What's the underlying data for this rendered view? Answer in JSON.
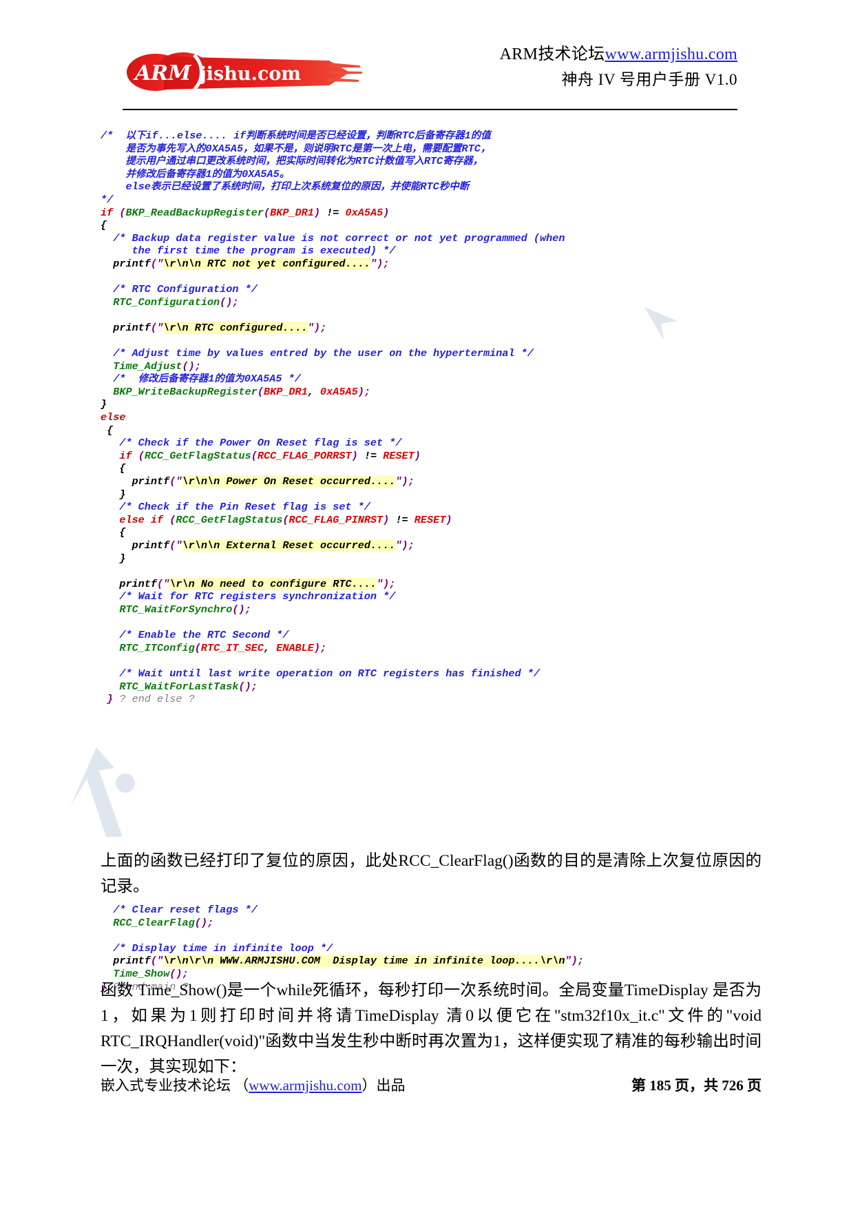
{
  "header": {
    "logo_alt": "ARMjishu.com",
    "logo_text_arm": "ARM",
    "logo_text_site": "jishu.com",
    "line1_prefix": "ARM技术论坛",
    "line1_url": "www.armjishu.com",
    "line2": "神舟 IV 号用户手册 V1.0"
  },
  "code": {
    "lines": [
      [
        {
          "t": "/*  ",
          "c": "c-comment"
        },
        {
          "t": "以下",
          "c": "c-cjk"
        },
        {
          "t": "if...else.... if",
          "c": "c-comment"
        },
        {
          "t": "判断系统时间是否已经设置，判断",
          "c": "c-cjk"
        },
        {
          "t": "RTC",
          "c": "c-comment"
        },
        {
          "t": "后备寄存器",
          "c": "c-cjk"
        },
        {
          "t": "1",
          "c": "c-comment"
        },
        {
          "t": "的值",
          "c": "c-cjk"
        }
      ],
      [
        {
          "t": "    ",
          "c": "c-comment"
        },
        {
          "t": "是否为事先写入的",
          "c": "c-cjk"
        },
        {
          "t": "0XA5A5",
          "c": "c-comment"
        },
        {
          "t": "，如果不是，则说明",
          "c": "c-cjk"
        },
        {
          "t": "RTC",
          "c": "c-comment"
        },
        {
          "t": "是第一次上电，需要配置",
          "c": "c-cjk"
        },
        {
          "t": "RTC",
          "c": "c-comment"
        },
        {
          "t": "，",
          "c": "c-cjk"
        }
      ],
      [
        {
          "t": "    ",
          "c": "c-comment"
        },
        {
          "t": "提示用户通过串口更改系统时间，把实际时间转化为",
          "c": "c-cjk"
        },
        {
          "t": "RTC",
          "c": "c-comment"
        },
        {
          "t": "计数值写入",
          "c": "c-cjk"
        },
        {
          "t": "RTC",
          "c": "c-comment"
        },
        {
          "t": "寄存器，",
          "c": "c-cjk"
        }
      ],
      [
        {
          "t": "    ",
          "c": "c-comment"
        },
        {
          "t": "并修改后备寄存器",
          "c": "c-cjk"
        },
        {
          "t": "1",
          "c": "c-comment"
        },
        {
          "t": "的值为",
          "c": "c-cjk"
        },
        {
          "t": "0XA5A5",
          "c": "c-comment"
        },
        {
          "t": "。",
          "c": "c-cjk"
        }
      ],
      [
        {
          "t": "    else",
          "c": "c-comment"
        },
        {
          "t": "表示已经设置了系统时间，打印上次系统复位的原因，并使能",
          "c": "c-cjk"
        },
        {
          "t": "RTC",
          "c": "c-comment"
        },
        {
          "t": "秒中断",
          "c": "c-cjk"
        }
      ],
      [
        {
          "t": "*/",
          "c": "c-comment"
        }
      ],
      [
        {
          "t": "if",
          "c": "c-kw"
        },
        {
          "t": " (",
          "c": "c-punc"
        },
        {
          "t": "BKP_ReadBackupRegister",
          "c": "c-fn"
        },
        {
          "t": "(",
          "c": "c-punc"
        },
        {
          "t": "BKP_DR1",
          "c": "c-const"
        },
        {
          "t": ")",
          "c": "c-punc"
        },
        {
          "t": " != ",
          "c": "c-plain"
        },
        {
          "t": "0xA5A5",
          "c": "c-const"
        },
        {
          "t": ")",
          "c": "c-punc"
        }
      ],
      [
        {
          "t": "{",
          "c": "c-plain"
        }
      ],
      [
        {
          "t": "  /* Backup data register value is not correct or not yet programmed (when",
          "c": "c-comment"
        }
      ],
      [
        {
          "t": "     the first time the program is executed) */",
          "c": "c-comment"
        }
      ],
      [
        {
          "t": "  printf",
          "c": "c-plain"
        },
        {
          "t": "(",
          "c": "c-punc"
        },
        {
          "t": "\"",
          "c": "c-strq"
        },
        {
          "t": "\\r\\n\\n RTC not yet configured....",
          "c": "c-str"
        },
        {
          "t": "\"",
          "c": "c-strq"
        },
        {
          "t": ")",
          "c": "c-punc"
        },
        {
          "t": ";",
          "c": "c-punc"
        }
      ],
      [],
      [
        {
          "t": "  /* RTC Configuration */",
          "c": "c-comment"
        }
      ],
      [
        {
          "t": "  RTC_Configuration",
          "c": "c-fn"
        },
        {
          "t": "();",
          "c": "c-punc"
        }
      ],
      [],
      [
        {
          "t": "  printf",
          "c": "c-plain"
        },
        {
          "t": "(",
          "c": "c-punc"
        },
        {
          "t": "\"",
          "c": "c-strq"
        },
        {
          "t": "\\r\\n RTC configured....",
          "c": "c-str"
        },
        {
          "t": "\"",
          "c": "c-strq"
        },
        {
          "t": ");",
          "c": "c-punc"
        }
      ],
      [],
      [
        {
          "t": "  /* Adjust time by values entred by the user on the hyperterminal */",
          "c": "c-comment"
        }
      ],
      [
        {
          "t": "  Time_Adjust",
          "c": "c-fn"
        },
        {
          "t": "();",
          "c": "c-punc"
        }
      ],
      [
        {
          "t": "  /*  ",
          "c": "c-comment"
        },
        {
          "t": "修改后备寄存器",
          "c": "c-cjk"
        },
        {
          "t": "1",
          "c": "c-comment"
        },
        {
          "t": "的值为",
          "c": "c-cjk"
        },
        {
          "t": "0XA5A5 */",
          "c": "c-comment"
        }
      ],
      [
        {
          "t": "  BKP_WriteBackupRegister",
          "c": "c-fn"
        },
        {
          "t": "(",
          "c": "c-punc"
        },
        {
          "t": "BKP_DR1",
          "c": "c-const"
        },
        {
          "t": ", ",
          "c": "c-plain"
        },
        {
          "t": "0xA5A5",
          "c": "c-const"
        },
        {
          "t": ");",
          "c": "c-punc"
        }
      ],
      [
        {
          "t": "}",
          "c": "c-plain"
        }
      ],
      [
        {
          "t": "else",
          "c": "c-kw"
        }
      ],
      [
        {
          "t": " {",
          "c": "c-plain"
        }
      ],
      [
        {
          "t": "   /* Check if the Power On Reset flag is set */",
          "c": "c-comment"
        }
      ],
      [
        {
          "t": "   if",
          "c": "c-kw"
        },
        {
          "t": " (",
          "c": "c-punc"
        },
        {
          "t": "RCC_GetFlagStatus",
          "c": "c-fn"
        },
        {
          "t": "(",
          "c": "c-punc"
        },
        {
          "t": "RCC_FLAG_PORRST",
          "c": "c-const"
        },
        {
          "t": ")",
          "c": "c-punc"
        },
        {
          "t": " != ",
          "c": "c-plain"
        },
        {
          "t": "RESET",
          "c": "c-const"
        },
        {
          "t": ")",
          "c": "c-punc"
        }
      ],
      [
        {
          "t": "   {",
          "c": "c-plain"
        }
      ],
      [
        {
          "t": "     printf",
          "c": "c-plain"
        },
        {
          "t": "(",
          "c": "c-punc"
        },
        {
          "t": "\"",
          "c": "c-strq"
        },
        {
          "t": "\\r\\n\\n Power On Reset occurred....",
          "c": "c-str"
        },
        {
          "t": "\"",
          "c": "c-strq"
        },
        {
          "t": ");",
          "c": "c-punc"
        }
      ],
      [
        {
          "t": "   }",
          "c": "c-plain"
        }
      ],
      [
        {
          "t": "   /* Check if the Pin Reset flag is set */",
          "c": "c-comment"
        }
      ],
      [
        {
          "t": "   else if",
          "c": "c-kw"
        },
        {
          "t": " (",
          "c": "c-punc"
        },
        {
          "t": "RCC_GetFlagStatus",
          "c": "c-fn"
        },
        {
          "t": "(",
          "c": "c-punc"
        },
        {
          "t": "RCC_FLAG_PINRST",
          "c": "c-const"
        },
        {
          "t": ")",
          "c": "c-punc"
        },
        {
          "t": " != ",
          "c": "c-plain"
        },
        {
          "t": "RESET",
          "c": "c-const"
        },
        {
          "t": ")",
          "c": "c-punc"
        }
      ],
      [
        {
          "t": "   {",
          "c": "c-plain"
        }
      ],
      [
        {
          "t": "     printf",
          "c": "c-plain"
        },
        {
          "t": "(",
          "c": "c-punc"
        },
        {
          "t": "\"",
          "c": "c-strq"
        },
        {
          "t": "\\r\\n\\n External Reset occurred....",
          "c": "c-str"
        },
        {
          "t": "\"",
          "c": "c-strq"
        },
        {
          "t": ");",
          "c": "c-punc"
        }
      ],
      [
        {
          "t": "   }",
          "c": "c-plain"
        }
      ],
      [],
      [
        {
          "t": "   printf",
          "c": "c-plain"
        },
        {
          "t": "(",
          "c": "c-punc"
        },
        {
          "t": "\"",
          "c": "c-strq"
        },
        {
          "t": "\\r\\n No need to configure RTC....",
          "c": "c-str"
        },
        {
          "t": "\"",
          "c": "c-strq"
        },
        {
          "t": ");",
          "c": "c-punc"
        }
      ],
      [
        {
          "t": "   /* Wait for RTC registers synchronization */",
          "c": "c-comment"
        }
      ],
      [
        {
          "t": "   RTC_WaitForSynchro",
          "c": "c-fn"
        },
        {
          "t": "();",
          "c": "c-punc"
        }
      ],
      [],
      [
        {
          "t": "   /* Enable the RTC Second */",
          "c": "c-comment"
        }
      ],
      [
        {
          "t": "   RTC_ITConfig",
          "c": "c-fn"
        },
        {
          "t": "(",
          "c": "c-punc"
        },
        {
          "t": "RTC_IT_SEC",
          "c": "c-const"
        },
        {
          "t": ", ",
          "c": "c-plain"
        },
        {
          "t": "ENABLE",
          "c": "c-const"
        },
        {
          "t": ");",
          "c": "c-punc"
        }
      ],
      [],
      [
        {
          "t": "   /* Wait until last write operation on RTC registers has finished */",
          "c": "c-comment"
        }
      ],
      [
        {
          "t": "   RTC_WaitForLastTask",
          "c": "c-fn"
        },
        {
          "t": "();",
          "c": "c-punc"
        }
      ],
      [
        {
          "t": " }",
          "c": "c-punc"
        },
        {
          "t": " ? end else ?",
          "c": "c-gray"
        }
      ]
    ],
    "lines2": [
      [
        {
          "t": "  /* Clear reset flags */",
          "c": "c-comment"
        }
      ],
      [
        {
          "t": "  RCC_ClearFlag",
          "c": "c-fn"
        },
        {
          "t": "();",
          "c": "c-punc"
        }
      ],
      [],
      [
        {
          "t": "  /* Display time in infinite loop */",
          "c": "c-comment"
        }
      ],
      [
        {
          "t": "  printf",
          "c": "c-plain"
        },
        {
          "t": "(",
          "c": "c-punc"
        },
        {
          "t": "\"",
          "c": "c-strq"
        },
        {
          "t": "\\r\\n\\r\\n WWW.ARMJISHU.COM  Display time in infinite loop....\\r\\n",
          "c": "c-str"
        },
        {
          "t": "\"",
          "c": "c-strq"
        },
        {
          "t": ");",
          "c": "c-punc"
        }
      ],
      [
        {
          "t": "  Time_Show",
          "c": "c-fn"
        },
        {
          "t": "();",
          "c": "c-punc"
        }
      ],
      [
        {
          "t": "}",
          "c": "c-punc"
        },
        {
          "t": " ? end main ?",
          "c": "c-gray"
        }
      ]
    ]
  },
  "paragraphs": {
    "p1": "上面的函数已经打印了复位的原因，此处RCC_ClearFlag()函数的目的是清除上次复位原因的记录。",
    "p2": "函数 Time_Show()是一个while死循环，每秒打印一次系统时间。全局变量TimeDisplay 是否为1，如果为1则打印时间并将请TimeDisplay 清0以便它在\"stm32f10x_it.c\"文件的\"void RTC_IRQHandler(void)\"函数中当发生秒中断时再次置为1，这样便实现了精准的每秒输出时间一次，其实现如下："
  },
  "footer": {
    "left_prefix": "嵌入式专业技术论坛 （",
    "left_link": "www.armjishu.com",
    "left_suffix": "）出品",
    "right": "第 185 页，共 726 页"
  },
  "colors": {
    "comment": "#2222dd",
    "keyword": "#cc0000",
    "function": "#0b7a0b",
    "constant": "#dd0000",
    "punctuation": "#770077",
    "string_bg": "#ffffbb",
    "link": "#2020d0",
    "logo_red": "#e01b1b"
  }
}
